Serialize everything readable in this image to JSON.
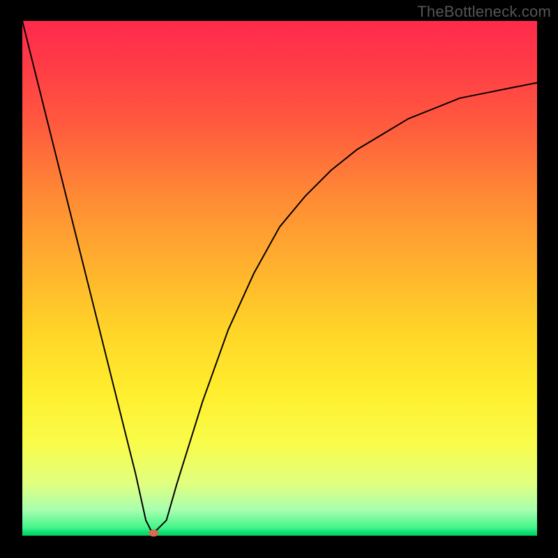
{
  "watermark": "TheBottleneck.com",
  "chart_data": {
    "type": "line",
    "title": "",
    "xlabel": "",
    "ylabel": "",
    "xlim": [
      0,
      100
    ],
    "ylim": [
      0,
      100
    ],
    "grid": false,
    "legend": false,
    "series": [
      {
        "name": "bottleneck-curve",
        "x": [
          0,
          5,
          10,
          15,
          20,
          22,
          24,
          25,
          26,
          28,
          30,
          35,
          40,
          45,
          50,
          55,
          60,
          65,
          70,
          75,
          80,
          85,
          90,
          95,
          100
        ],
        "y": [
          100,
          80,
          60,
          40,
          20,
          12,
          3,
          1,
          1,
          3,
          10,
          26,
          40,
          51,
          60,
          66,
          71,
          75,
          78,
          81,
          83,
          85,
          86,
          87,
          88
        ]
      }
    ],
    "annotations": [
      {
        "name": "min-marker",
        "x": 25.5,
        "y": 0.5,
        "color": "#d96b51"
      }
    ],
    "background_gradient": {
      "top": "#ff2a4d",
      "mid": "#ffe22e",
      "bottom": "#04cf55"
    }
  }
}
